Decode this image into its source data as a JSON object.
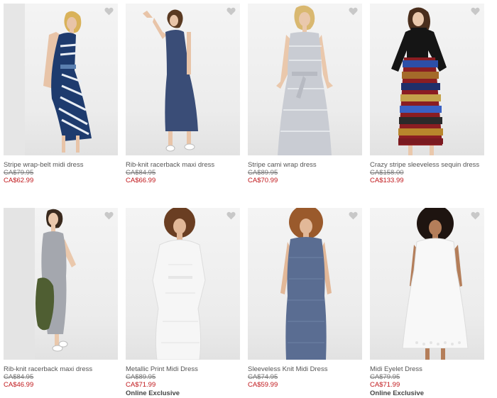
{
  "colors": {
    "sale": "#c0171b",
    "text": "#555555",
    "heart": "#c8c8c8"
  },
  "products": [
    {
      "name": "Stripe wrap-belt midi dress",
      "original_price": "CA$79.95",
      "sale_price": "CA$62.99",
      "badge": "",
      "image_icon": "woman-striped-wrap-dress-photo"
    },
    {
      "name": "Rib-knit racerback maxi dress",
      "original_price": "CA$84.95",
      "sale_price": "CA$66.99",
      "badge": "",
      "image_icon": "woman-navy-maxi-dress-photo"
    },
    {
      "name": "Stripe cami wrap dress",
      "original_price": "CA$89.95",
      "sale_price": "CA$70.99",
      "badge": "",
      "image_icon": "woman-grey-cami-dress-photo"
    },
    {
      "name": "Crazy stripe sleeveless sequin dress",
      "original_price": "CA$158.00",
      "sale_price": "CA$133.99",
      "badge": "",
      "image_icon": "woman-sequin-dress-photo"
    },
    {
      "name": "Rib-knit racerback maxi dress",
      "original_price": "CA$84.95",
      "sale_price": "CA$46.99",
      "badge": "",
      "image_icon": "woman-grey-maxi-dress-photo"
    },
    {
      "name": "Metallic Print Midi Dress",
      "original_price": "CA$89.95",
      "sale_price": "CA$71.99",
      "badge": "Online Exclusive",
      "image_icon": "woman-white-midi-dress-photo"
    },
    {
      "name": "Sleeveless Knit Midi Dress",
      "original_price": "CA$74.95",
      "sale_price": "CA$59.99",
      "badge": "",
      "image_icon": "woman-blue-knit-dress-photo"
    },
    {
      "name": "Midi Eyelet Dress",
      "original_price": "CA$79.95",
      "sale_price": "CA$71.99",
      "badge": "Online Exclusive",
      "image_icon": "woman-white-eyelet-dress-photo"
    }
  ]
}
